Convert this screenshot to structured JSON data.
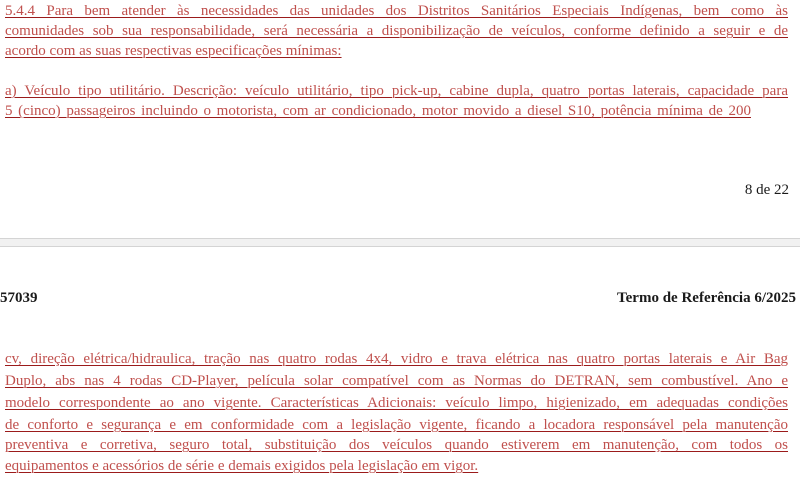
{
  "top_page": {
    "lines": [
      [
        "5.4.4 Para bem atender às necessidades das unidades dos Distritos Sanitários Especiais Indígenas, bem como às"
      ],
      [
        "comunidades sob sua responsabilidade, será necessária a disponibilização de veículos, conforme definido a seguir e de"
      ],
      [
        "acordo com as suas respectivas especificações mínimas:"
      ]
    ],
    "item_lines": [
      [
        "a) Veículo tipo utilitário. Descrição: veículo utilitário, tipo pick-up, cabine dupla, quatro portas laterais, capacidade para"
      ],
      [
        "5 (cinco) passageiros incluindo o motorista, com ar condicionado, motor movido a diesel S10, potência mínima de 200"
      ]
    ],
    "page_number": "8 de 22"
  },
  "bottom_page": {
    "header_left": "57039",
    "header_right": "Termo de Referência 6/2025",
    "lines": [
      "cv, direção elétrica/hidraulica, tração nas quatro rodas 4x4, vidro e trava elétrica nas quatro portas laterais e Air Bag",
      "Duplo, abs nas 4 rodas CD-Player, película solar compatível com as Normas do DETRAN, sem combustível. Ano e",
      "modelo correspondente ao ano vigente. Características Adicionais: veículo limpo, higienizado, em adequadas condições",
      "de conforto e segurança e em conformidade com a legislação vigente, ficando a locadora responsável pela manutenção",
      "preventiva e corretiva, seguro total, substituição dos veículos quando estiverem em manutenção, com todos os",
      "equipamentos e acessórios de série e demais exigidos pela legislação em vigor."
    ]
  },
  "colors": {
    "body_text": "#c0504d",
    "underline": "#9b1b1b",
    "header_text": "#1a1a1a",
    "page_gap": "#f1f1f1"
  }
}
